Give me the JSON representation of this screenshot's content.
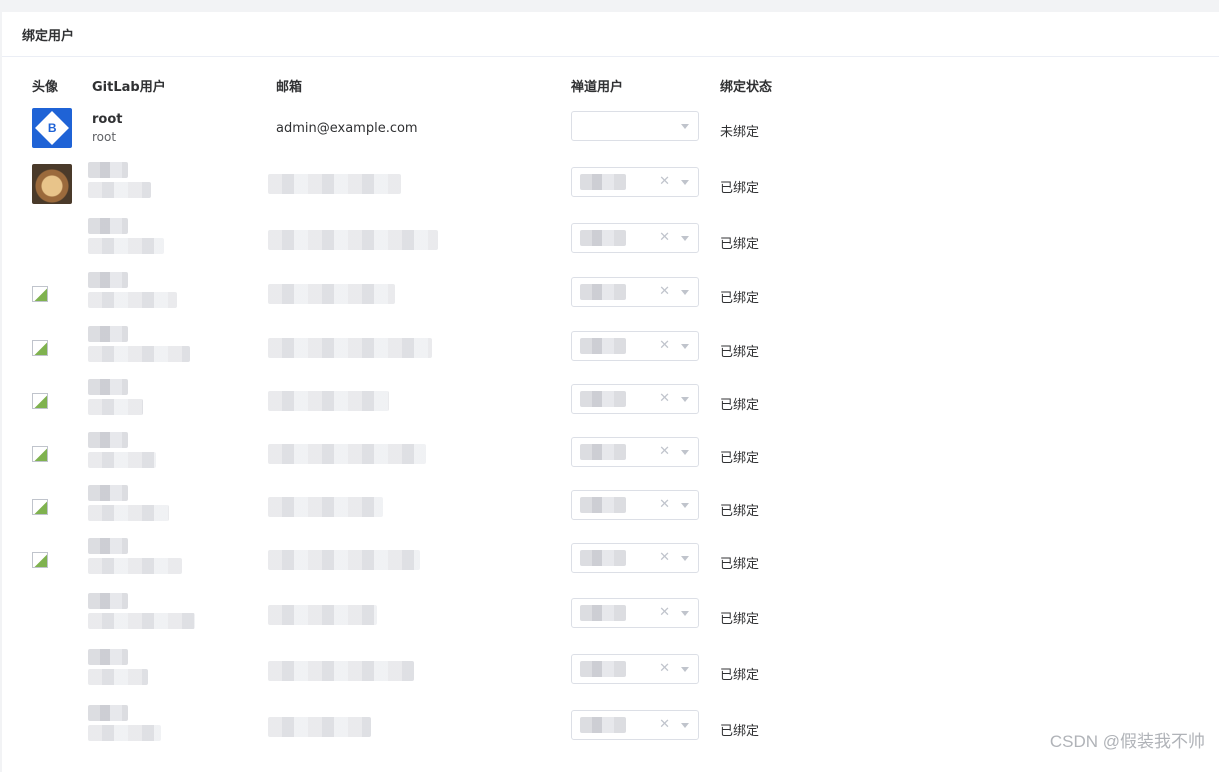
{
  "card": {
    "title": "绑定用户"
  },
  "columns": {
    "avatar": "头像",
    "gitlab_user": "GitLab用户",
    "email": "邮箱",
    "chandao_user": "禅道用户",
    "bind_status": "绑定状态"
  },
  "rows": [
    {
      "avatar": "logo",
      "name": "root",
      "username": "root",
      "email": "admin@example.com",
      "selected": "",
      "clearable": false,
      "status": "未绑定"
    },
    {
      "avatar": "photo",
      "name": "",
      "username": "",
      "email": "",
      "selected": "",
      "clearable": true,
      "status": "已绑定"
    },
    {
      "avatar": "none",
      "name": "",
      "username": "",
      "email": "",
      "selected": "",
      "clearable": true,
      "status": "已绑定"
    },
    {
      "avatar": "broken",
      "name": "",
      "username": "",
      "email": "",
      "selected": "",
      "clearable": true,
      "status": "已绑定"
    },
    {
      "avatar": "broken",
      "name": "",
      "username": "",
      "email": "",
      "selected": "",
      "clearable": true,
      "status": "已绑定"
    },
    {
      "avatar": "broken",
      "name": "",
      "username": "",
      "email": "",
      "selected": "",
      "clearable": true,
      "status": "已绑定"
    },
    {
      "avatar": "broken",
      "name": "",
      "username": "",
      "email": "",
      "selected": "",
      "clearable": true,
      "status": "已绑定"
    },
    {
      "avatar": "broken",
      "name": "",
      "username": "",
      "email": "",
      "selected": "",
      "clearable": true,
      "status": "已绑定"
    },
    {
      "avatar": "broken",
      "name": "",
      "username": "",
      "email": "",
      "selected": "",
      "clearable": true,
      "status": "已绑定"
    },
    {
      "avatar": "none",
      "name": "",
      "username": "",
      "email": "",
      "selected": "",
      "clearable": true,
      "status": "已绑定"
    },
    {
      "avatar": "none",
      "name": "",
      "username": "",
      "email": "",
      "selected": "",
      "clearable": true,
      "status": "已绑定"
    },
    {
      "avatar": "none",
      "name": "",
      "username": "",
      "email": "",
      "selected": "",
      "clearable": true,
      "status": "已绑定"
    }
  ],
  "icons": {
    "clear": "close-icon",
    "dropdown": "chevron-down-icon",
    "logo_letter": "B"
  },
  "watermark": "CSDN @假装我不帅"
}
